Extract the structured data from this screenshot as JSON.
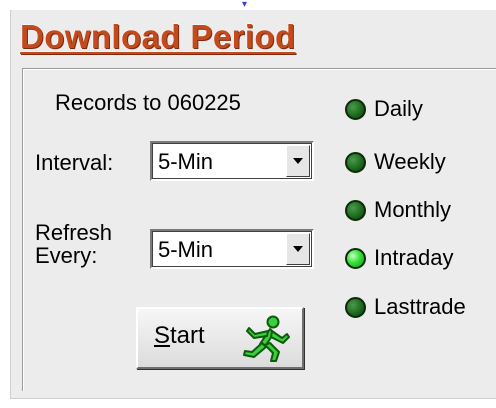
{
  "title": "Download Period",
  "records": {
    "text": "Records to 060225"
  },
  "interval": {
    "label": "Interval:",
    "value": "5-Min"
  },
  "refresh": {
    "label_line1": "Refresh",
    "label_line2": "Every:",
    "value": "5-Min"
  },
  "start_button": {
    "mnemonic": "S",
    "rest": "tart"
  },
  "period_options": [
    {
      "label": "Daily",
      "selected": false
    },
    {
      "label": "Weekly",
      "selected": false
    },
    {
      "label": "Monthly",
      "selected": false
    },
    {
      "label": "Intraday",
      "selected": true
    },
    {
      "label": "Lasttrade",
      "selected": false
    }
  ],
  "colors": {
    "title": "#c24a1c",
    "radio_selected": "#36e036",
    "radio_unselected": "#1f6a1f",
    "panel_bg": "#ececec"
  },
  "icons": {
    "start": "running-man-icon",
    "dropdown": "chevron-down-icon"
  }
}
